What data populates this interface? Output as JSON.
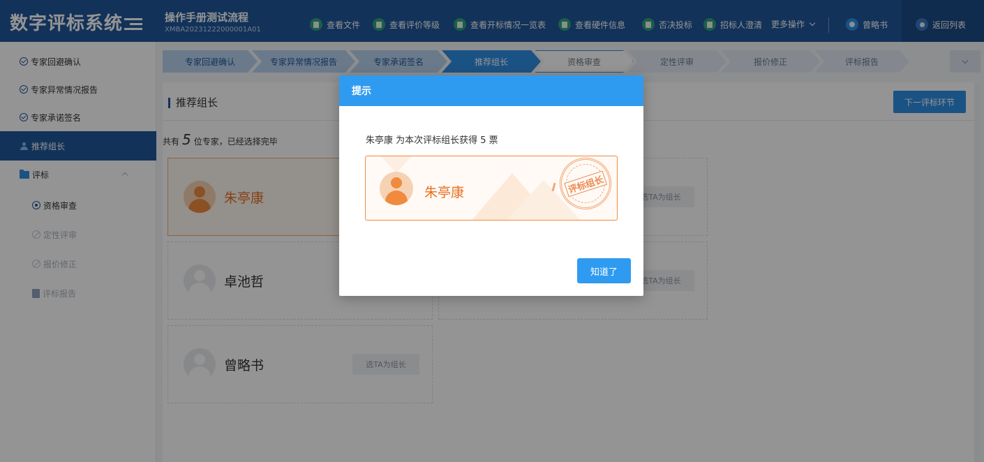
{
  "app": {
    "title": "数字评标系统"
  },
  "project": {
    "title": "操作手册测试流程",
    "code": "XMBA20231222000001A01"
  },
  "header_actions": [
    "查看文件",
    "查看评价等级",
    "查看开标情况一览表",
    "查看硬件信息",
    "否决投标",
    "招标人澄清"
  ],
  "more_actions": "更多操作",
  "user_name": "曾略书",
  "back_label": "返回列表",
  "sidebar": {
    "items": [
      {
        "label": "专家回避确认"
      },
      {
        "label": "专家异常情况报告"
      },
      {
        "label": "专家承诺签名"
      },
      {
        "label": "推荐组长"
      },
      {
        "label": "评标"
      },
      {
        "label": "资格审查"
      },
      {
        "label": "定性评审"
      },
      {
        "label": "报价修正"
      },
      {
        "label": "评标报告"
      }
    ]
  },
  "steps": [
    {
      "label": "专家回避确认",
      "state": "done"
    },
    {
      "label": "专家异常情况报告",
      "state": "done"
    },
    {
      "label": "专家承诺签名",
      "state": "done"
    },
    {
      "label": "推荐组长",
      "state": "current"
    },
    {
      "label": "资格审查",
      "state": "next"
    },
    {
      "label": "定性评审",
      "state": "todo"
    },
    {
      "label": "报价修正",
      "state": "todo"
    },
    {
      "label": "评标报告",
      "state": "todo"
    }
  ],
  "panel": {
    "title": "推荐组长",
    "next_button": "下一评标环节",
    "summary_prefix": "共有",
    "summary_count": "5",
    "summary_suffix": "位专家，已经选择完毕"
  },
  "experts": [
    {
      "name": "朱亭康",
      "pick_label": "选TA为组长",
      "selected": true
    },
    {
      "name": "卓池哲",
      "pick_label": "选TA为组长",
      "selected": false
    },
    {
      "name": "曾略书",
      "pick_label": "选TA为组长",
      "selected": false
    }
  ],
  "modal": {
    "title": "提示",
    "message": "朱亭康 为本次评标组长获得 5 票",
    "leader_name": "朱亭康",
    "stamp_text": "评标组长",
    "ok_button": "知道了"
  },
  "colors": {
    "header_bg": "#20569a",
    "accent_blue": "#2f8de4",
    "modal_header": "#2f9bf0",
    "leader_orange": "#e86f22"
  }
}
